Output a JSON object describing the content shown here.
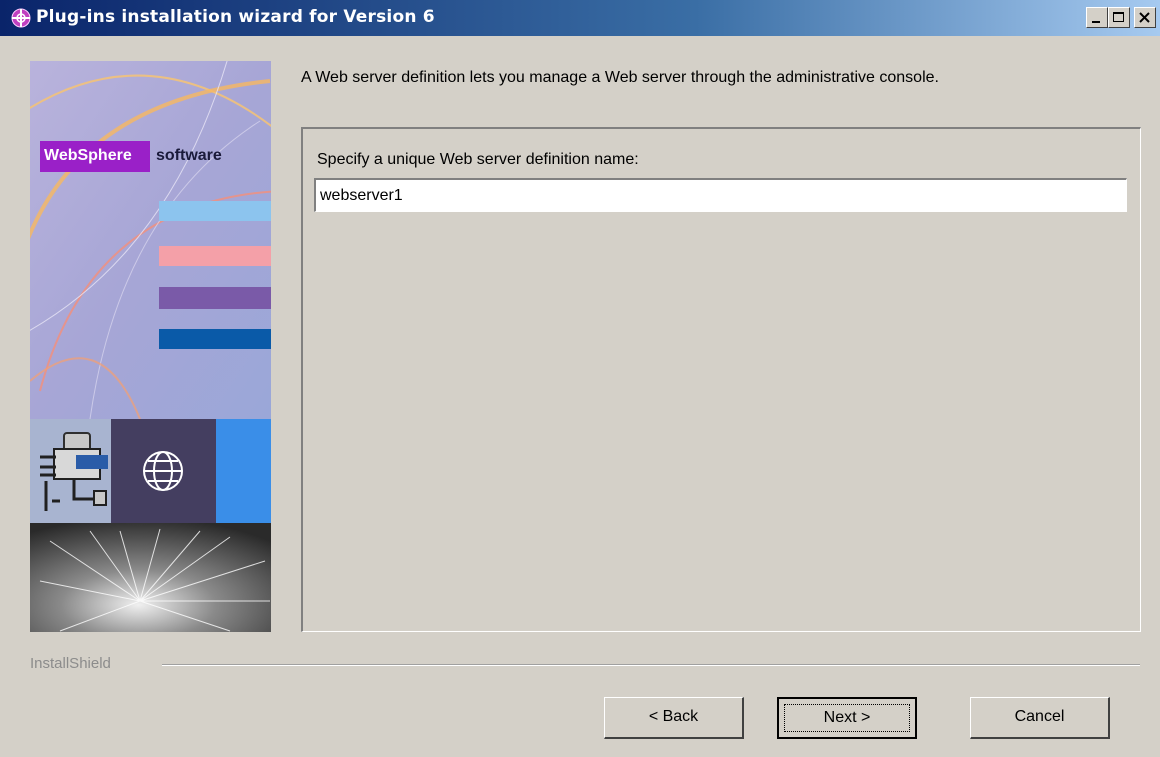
{
  "window": {
    "title": "Plug-ins installation wizard for Version 6",
    "colors": {
      "titlebar_start": "#0a246a",
      "titlebar_end": "#a6caf0",
      "background": "#d4d0c8"
    }
  },
  "side_panel": {
    "brand": "WebSphere",
    "brand_suffix": "software",
    "icons": [
      "plug-connector-icon",
      "globe-icon"
    ]
  },
  "intro_text": "A Web server definition lets you manage a Web server through the administrative console.",
  "form": {
    "label": "Specify a unique Web server definition name:",
    "value": "webserver1"
  },
  "installshield_label": "InstallShield",
  "buttons": {
    "back": "< Back",
    "next": "Next >",
    "cancel": "Cancel"
  }
}
